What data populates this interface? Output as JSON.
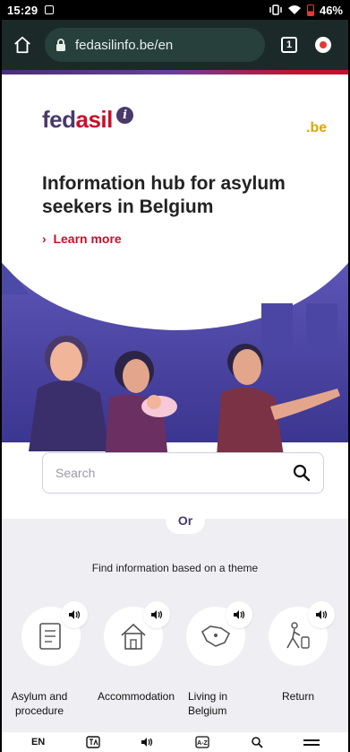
{
  "status": {
    "time": "15:29",
    "battery": "46%"
  },
  "browser": {
    "url": "fedasilinfo.be/en",
    "tab_count": "1"
  },
  "logo": {
    "part1": "fed",
    "part2": "asil",
    "gov_logo": ".be"
  },
  "hero": {
    "title": "Information hub for asylum seekers in Belgium",
    "learn_more": "Learn more"
  },
  "search": {
    "placeholder": "Search"
  },
  "divider": {
    "or": "Or"
  },
  "themes": {
    "heading": "Find information based on a theme",
    "items": [
      {
        "label": "Asylum and procedure",
        "icon": "document-icon"
      },
      {
        "label": "Accommodation",
        "icon": "house-icon"
      },
      {
        "label": "Living in Belgium",
        "icon": "belgium-map-icon"
      },
      {
        "label": "Return",
        "icon": "walking-person-icon"
      }
    ]
  },
  "bottom_bar": {
    "language": "EN",
    "items": [
      "translate-icon",
      "speaker-icon",
      "text-size-icon",
      "search-icon",
      "menu-icon"
    ]
  },
  "colors": {
    "brand_purple": "#4a3a6b",
    "brand_red": "#c8102e",
    "browser_bar": "#1b2a28"
  }
}
